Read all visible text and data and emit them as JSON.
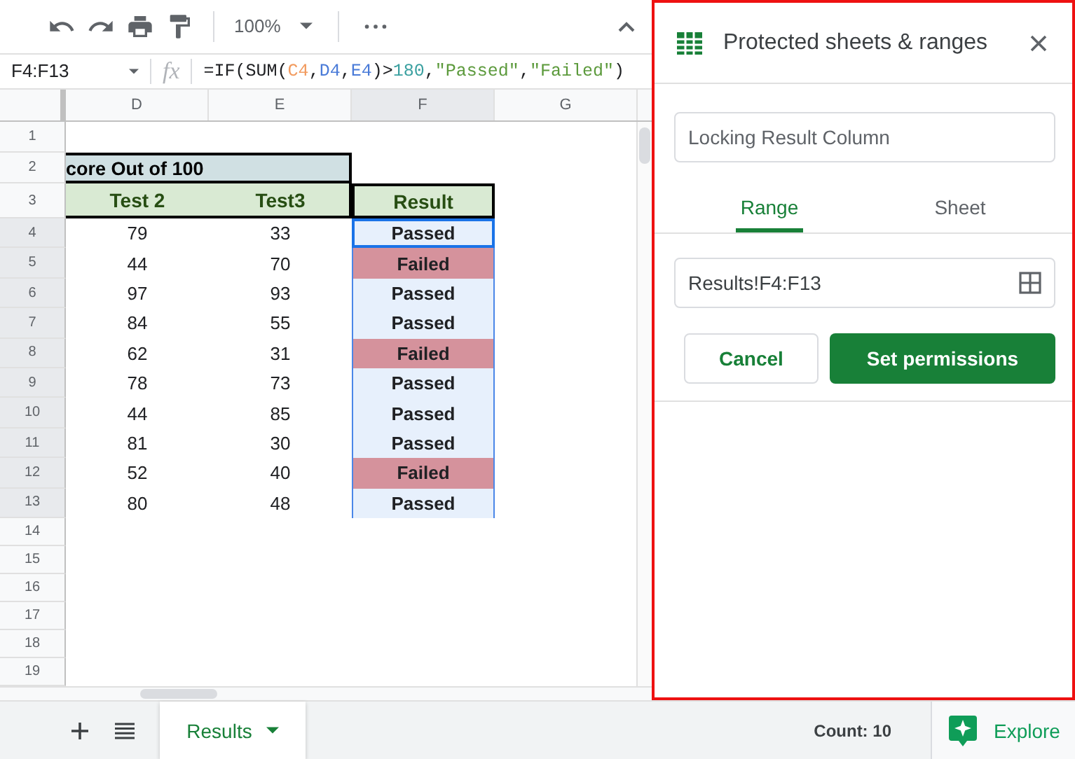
{
  "toolbar": {
    "zoom": "100%"
  },
  "formula_bar": {
    "cell_ref": "F4:F13",
    "fx": "fx",
    "formula": [
      {
        "text": "=IF(SUM(",
        "color": "#202124"
      },
      {
        "text": "C4",
        "color": "#f29b5f"
      },
      {
        "text": ",",
        "color": "#202124"
      },
      {
        "text": "D4",
        "color": "#4a7bd8"
      },
      {
        "text": ",",
        "color": "#202124"
      },
      {
        "text": "E4",
        "color": "#4a7bd8"
      },
      {
        "text": ")>",
        "color": "#202124"
      },
      {
        "text": "180",
        "color": "#3aa0a0"
      },
      {
        "text": ",",
        "color": "#202124"
      },
      {
        "text": "\"Passed\"",
        "color": "#5c9a3c"
      },
      {
        "text": ",",
        "color": "#202124"
      },
      {
        "text": "\"Failed\"",
        "color": "#5c9a3c"
      },
      {
        "text": ")",
        "color": "#202124"
      }
    ]
  },
  "columns": [
    {
      "label": "D",
      "selected": false
    },
    {
      "label": "E",
      "selected": false
    },
    {
      "label": "F",
      "selected": true
    },
    {
      "label": "G",
      "selected": false
    }
  ],
  "title_row": {
    "number": "1"
  },
  "score_row": {
    "number": "2",
    "text": "core Out of 100"
  },
  "header_row": {
    "number": "3",
    "cells": [
      "Test 2",
      "Test3",
      "Result"
    ]
  },
  "rows": [
    {
      "number": "4",
      "test_2": "79",
      "test3": "33",
      "result": "Passed",
      "kind": "passed",
      "selected": true,
      "active": true
    },
    {
      "number": "5",
      "test_2": "44",
      "test3": "70",
      "result": "Failed",
      "kind": "failed",
      "selected": true,
      "active": false
    },
    {
      "number": "6",
      "test_2": "97",
      "test3": "93",
      "result": "Passed",
      "kind": "passed",
      "selected": true,
      "active": false
    },
    {
      "number": "7",
      "test_2": "84",
      "test3": "55",
      "result": "Passed",
      "kind": "passed",
      "selected": true,
      "active": false
    },
    {
      "number": "8",
      "test_2": "62",
      "test3": "31",
      "result": "Failed",
      "kind": "failed",
      "selected": true,
      "active": false
    },
    {
      "number": "9",
      "test_2": "78",
      "test3": "73",
      "result": "Passed",
      "kind": "passed",
      "selected": true,
      "active": false
    },
    {
      "number": "10",
      "test_2": "44",
      "test3": "85",
      "result": "Passed",
      "kind": "passed",
      "selected": true,
      "active": false
    },
    {
      "number": "11",
      "test_2": "81",
      "test3": "30",
      "result": "Passed",
      "kind": "passed",
      "selected": true,
      "active": false
    },
    {
      "number": "12",
      "test_2": "52",
      "test3": "40",
      "result": "Failed",
      "kind": "failed",
      "selected": true,
      "active": false
    },
    {
      "number": "13",
      "test_2": "80",
      "test3": "48",
      "result": "Passed",
      "kind": "passed",
      "selected": true,
      "active": false
    }
  ],
  "empty_rows": [
    "14",
    "15",
    "16",
    "17",
    "18",
    "19"
  ],
  "sheet_tabs": [
    {
      "label": "Results",
      "selected": true
    }
  ],
  "status_bar": {
    "count": "Count: 10",
    "explore": "Explore"
  },
  "panel": {
    "title": "Protected sheets & ranges",
    "description": {
      "value": "Locking Result Column"
    },
    "tabs": [
      {
        "label": "Range",
        "selected": true
      },
      {
        "label": "Sheet",
        "selected": false
      }
    ],
    "range": {
      "value": "Results!F4:F13"
    },
    "buttons": [
      {
        "label": "Cancel",
        "kind": "secondary"
      },
      {
        "label": "Set permissions",
        "kind": "primary"
      }
    ]
  }
}
